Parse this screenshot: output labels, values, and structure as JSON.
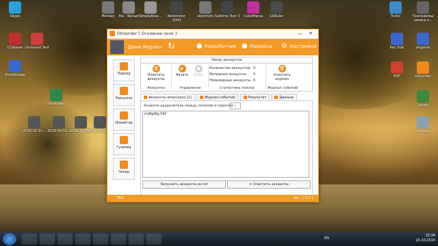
{
  "desktop_icons": [
    {
      "label": "Skype",
      "color": "#2aa0e0"
    },
    {
      "label": "CCleaner",
      "color": "#c03030"
    },
    {
      "label": "Unshared Text",
      "color": "#d04040"
    },
    {
      "label": "PhotoScape",
      "color": "#3a6ad0"
    },
    {
      "label": "Uninstaller",
      "color": "#2a8a4a"
    },
    {
      "label": "2016-10-15...",
      "color": "#555555"
    },
    {
      "label": "2016-10-15...",
      "color": "#555555"
    },
    {
      "label": "2016-10-15...",
      "color": "#555555"
    },
    {
      "label": "2016-10-15...",
      "color": "#555555"
    },
    {
      "label": "Monkey",
      "color": "#777777"
    },
    {
      "label": "file - Ярлык",
      "color": "#888888"
    },
    {
      "label": "SimpleAsse...",
      "color": "#999999"
    },
    {
      "label": "Restorator 2009",
      "color": "#444444"
    },
    {
      "label": "sketchots",
      "color": "#777777"
    },
    {
      "label": "Sublime Text 3",
      "color": "#444444"
    },
    {
      "label": "ColorMania",
      "color": "#c030a0"
    },
    {
      "label": "GSRuler",
      "color": "#4a4a4a"
    },
    {
      "label": "Turbo",
      "color": "#3a8ad0"
    },
    {
      "label": "Программы записи э...",
      "color": "#666666"
    },
    {
      "label": "Key Stat",
      "color": "#3a6ad0"
    },
    {
      "label": "okgame",
      "color": "#3a6ad0"
    },
    {
      "label": "PDF",
      "color": "#d04030"
    },
    {
      "label": "OkSender",
      "color": "#f08a1c"
    },
    {
      "label": "Банер",
      "color": "#3a8a3a"
    },
    {
      "label": "Корзина",
      "color": "#8aa0b0"
    }
  ],
  "window": {
    "title": "OkSender [ Основное окно ]",
    "minimize": "—",
    "close": "✕",
    "user_name": "Дима Мурзин",
    "header_buttons": {
      "developer": "Разработчик",
      "macros": "Макросы",
      "settings": "Настройки"
    },
    "sidebar": [
      {
        "label": "Парсер"
      },
      {
        "label": "Рассылка"
      },
      {
        "label": "Инвайтер"
      },
      {
        "label": "Гулялка"
      },
      {
        "label": "Чекер"
      }
    ],
    "panel_title": "Чекер аккаунтов",
    "accounts_group": {
      "button": "Очистить аккаунты",
      "label": "Аккаунты"
    },
    "control_group": {
      "start": "Начать",
      "stop": "Стоп",
      "label": "Управление"
    },
    "stats": {
      "total_label": "Количество аккаунтов :",
      "total": "0",
      "valid_label": "Валидные аккаунты :",
      "valid": "0",
      "invalid_label": "Невалидные аккаунты :",
      "invalid": "0",
      "label": "Статистика поиска"
    },
    "log_group": {
      "button": "Очистить журнал",
      "label": "Журнал событий"
    },
    "tabs": [
      {
        "label": "Аккаунты email:pass [1]"
      },
      {
        "label": "Журнал событий"
      },
      {
        "label": "Результат"
      },
      {
        "label": "Данные"
      }
    ],
    "separator_label": "Укажите разделитель между логином и паролем :",
    "separator_value": ":",
    "accounts_text": "mdfgdfg;342",
    "load_button": "Загрузить аккаунты из txt",
    "clear_button": "Очистить аккаунты",
    "faq": "FAQ",
    "version": "Ver : [ 0.2 ]"
  },
  "taskbar": {
    "lang": "EN",
    "time": "15:34",
    "date": "15.10.2016"
  }
}
